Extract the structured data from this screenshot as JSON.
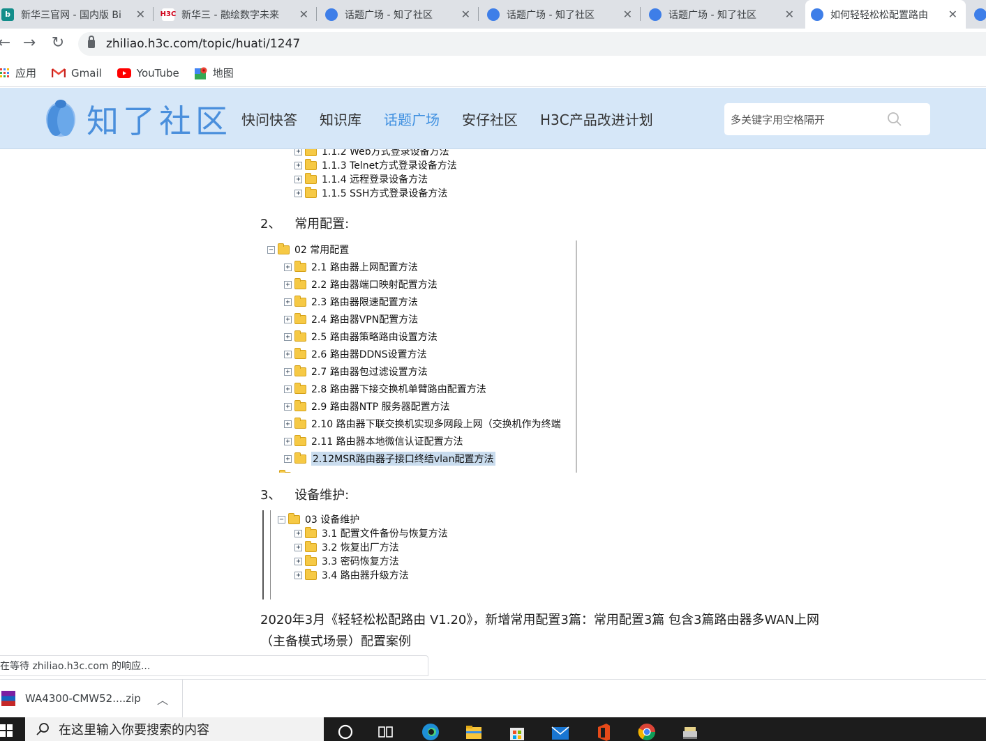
{
  "tabs": [
    {
      "title": "新华三官网 - 国内版 Bi",
      "favicon": "bing-icon"
    },
    {
      "title": "新华三 - 融绘数字未来",
      "favicon": "h3c-icon"
    },
    {
      "title": "话题广场 - 知了社区",
      "favicon": "zhiliao-icon"
    },
    {
      "title": "话题广场 - 知了社区",
      "favicon": "zhiliao-icon"
    },
    {
      "title": "话题广场 - 知了社区",
      "favicon": "zhiliao-icon"
    },
    {
      "title": "如何轻轻松松配置路由",
      "favicon": "zhiliao-icon"
    }
  ],
  "favicons": {
    "h3c": "H3C"
  },
  "address": {
    "url": "zhiliao.h3c.com/topic/huati/1247"
  },
  "bookmarks": [
    {
      "label": "应用",
      "icon": "apps-grid-icon"
    },
    {
      "label": "Gmail",
      "icon": "gmail-icon"
    },
    {
      "label": "YouTube",
      "icon": "youtube-icon"
    },
    {
      "label": "地图",
      "icon": "maps-icon"
    }
  ],
  "site": {
    "logo_text": "知了社区",
    "nav": [
      "快问快答",
      "知识库",
      "话题广场",
      "安仔社区",
      "H3C产品改进计划"
    ],
    "active_nav": "话题广场",
    "search_placeholder": "多关键字用空格隔开"
  },
  "article": {
    "tree1_rows": [
      "1.1.2 Web方式登录设备方法",
      "1.1.3 Telnet方式登录设备方法",
      "1.1.4 远程登录设备方法",
      "1.1.5 SSH方式登录设备方法"
    ],
    "section2": {
      "num": "2、",
      "title": "常用配置:"
    },
    "tree2_root": "02 常用配置",
    "tree2_rows": [
      "2.1 路由器上网配置方法",
      "2.2 路由器端口映射配置方法",
      "2.3 路由器限速配置方法",
      "2.4 路由器VPN配置方法",
      "2.5 路由器策略路由设置方法",
      "2.6 路由器DDNS设置方法",
      "2.7 路由器包过滤设置方法",
      "2.8 路由器下接交换机单臂路由配置方法",
      "2.9 路由器NTP 服务器配置方法",
      "2.10 路由器下联交换机实现多网段上网（交换机作为终端",
      "2.11 路由器本地微信认证配置方法",
      "2.12MSR路由器子接口终结vlan配置方法"
    ],
    "section3": {
      "num": "3、",
      "title": "设备维护:"
    },
    "tree3_root": "03 设备维护",
    "tree3_rows": [
      "3.1 配置文件备份与恢复方法",
      "3.2 恢复出厂方法",
      "3.3 密码恢复方法",
      "3.4 路由器升级方法"
    ],
    "paragraph_line1": "2020年3月《轻轻松松配路由 V1.20》，新增常用配置3篇：常用配置3篇  包含3篇路由器多WAN上网",
    "paragraph_line2": "（主备模式场景）配置案例"
  },
  "status_text": "在等待 zhiliao.h3c.com 的响应...",
  "download": {
    "filename": "WA4300-CMW52....zip"
  },
  "taskbar": {
    "search_placeholder": "在这里输入你要搜索的内容"
  },
  "colors": {
    "header_bg": "#d6e7f8",
    "brand_blue": "#4a8fdc",
    "active_nav": "#3e8fe0"
  }
}
